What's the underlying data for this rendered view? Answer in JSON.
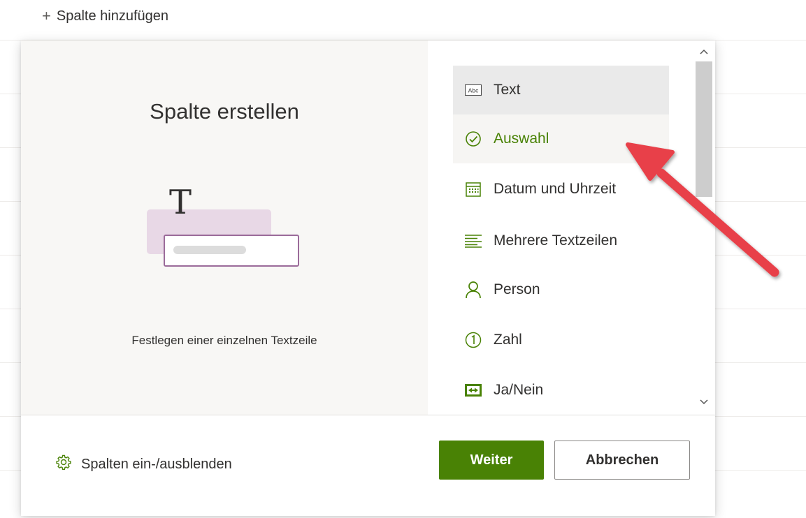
{
  "header": {
    "add_column_label": "Spalte hinzufügen"
  },
  "dialog": {
    "title": "Spalte erstellen",
    "description": "Festlegen einer einzelnen Textzeile",
    "illustration_letter": "T",
    "column_types": [
      {
        "label": "Text",
        "icon": "text-abc-icon",
        "state": "selected"
      },
      {
        "label": "Auswahl",
        "icon": "choice-check-icon",
        "state": "hovered"
      },
      {
        "label": "Datum und Uhrzeit",
        "icon": "calendar-icon",
        "state": "normal"
      },
      {
        "label": "Mehrere Textzeilen",
        "icon": "multiline-text-icon",
        "state": "normal"
      },
      {
        "label": "Person",
        "icon": "person-icon",
        "state": "normal"
      },
      {
        "label": "Zahl",
        "icon": "number-icon",
        "state": "normal"
      },
      {
        "label": "Ja/Nein",
        "icon": "yes-no-icon",
        "state": "normal"
      }
    ],
    "footer": {
      "show_hide_label": "Spalten ein-/ausblenden",
      "next_button": "Weiter",
      "cancel_button": "Abbrechen"
    }
  },
  "colors": {
    "accent_green": "#498205",
    "illustration_purple": "#9b6b9a",
    "annotation_arrow": "#e8404a"
  }
}
